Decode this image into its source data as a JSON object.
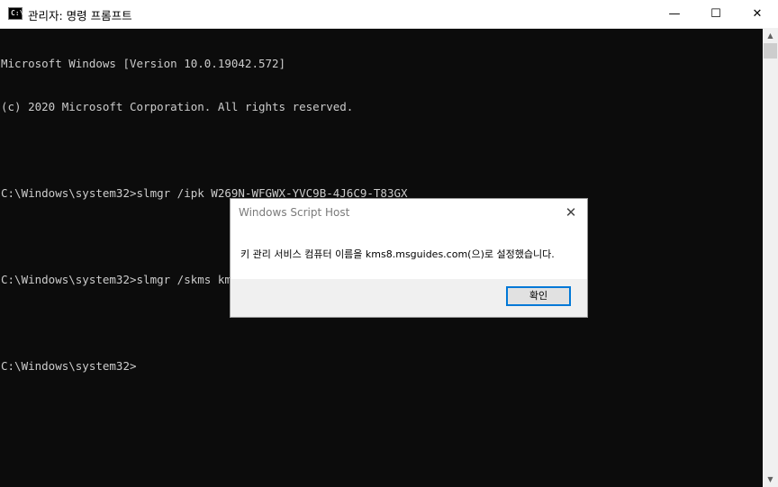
{
  "window": {
    "title": "관리자: 명령 프롬프트",
    "icon_text": "C:\\",
    "minimize_glyph": "—",
    "maximize_glyph": "☐",
    "close_glyph": "✕"
  },
  "console": {
    "lines": [
      "Microsoft Windows [Version 10.0.19042.572]",
      "(c) 2020 Microsoft Corporation. All rights reserved.",
      "",
      "C:\\Windows\\system32>slmgr /ipk W269N-WFGWX-YVC9B-4J6C9-T83GX",
      "",
      "C:\\Windows\\system32>slmgr /skms kms8.msguides.com",
      "",
      "C:\\Windows\\system32>"
    ]
  },
  "scrollbar": {
    "up_glyph": "▲",
    "down_glyph": "▼"
  },
  "dialog": {
    "title": "Windows Script Host",
    "close_glyph": "✕",
    "message": "키 관리 서비스 컴퓨터 이름을 kms8.msguides.com(으)로 설정했습니다.",
    "ok_label": "확인"
  },
  "colors": {
    "console_bg": "#0c0c0c",
    "console_text": "#cccccc",
    "accent": "#0078d7"
  }
}
